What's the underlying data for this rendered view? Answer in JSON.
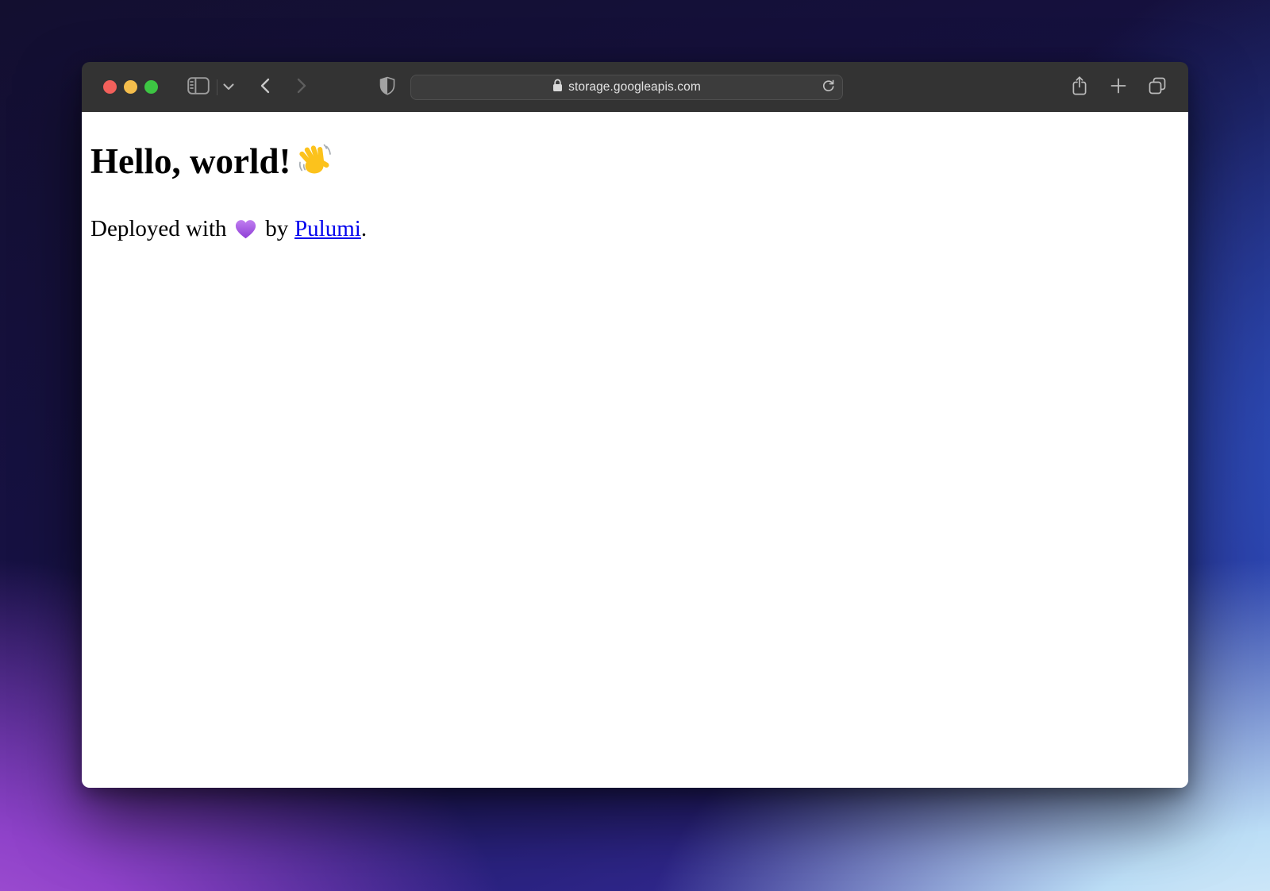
{
  "browser": {
    "url": "storage.googleapis.com",
    "toolbar_icons": [
      "sidebar-toggle-icon",
      "chevron-down-icon",
      "back-icon",
      "forward-icon",
      "privacy-shield-icon",
      "lock-icon",
      "reload-icon",
      "share-icon",
      "new-tab-plus-icon",
      "tab-overview-icon"
    ],
    "traffic_light_colors": {
      "close": "#f2605b",
      "minimize": "#f4bd4c",
      "zoom": "#3dc543"
    },
    "toolbar_bg": "#333333",
    "urlbar_bg": "#3c3c3c"
  },
  "page": {
    "heading": "Hello, world!",
    "wave_emoji": "👋",
    "deployed_prefix": "Deployed with",
    "heart_emoji": "💜",
    "deployed_connector": "by",
    "link_label": "Pulumi",
    "sentence_period": ".",
    "link_color": "#0000EE",
    "heart_color": "#a35ce0",
    "hand_color": "#fcc21c"
  }
}
